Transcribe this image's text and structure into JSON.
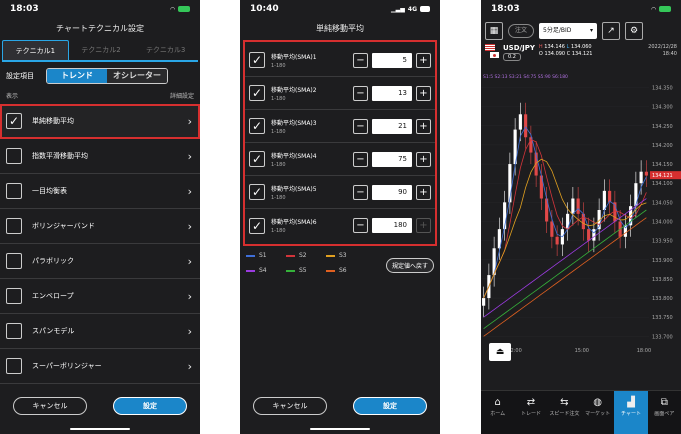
{
  "panel1": {
    "status": {
      "time": "18:03"
    },
    "title": "チャートテクニカル設定",
    "tabs": [
      "テクニカル1",
      "テクニカル2",
      "テクニカル3"
    ],
    "setting_label": "設定項目",
    "segments": [
      "トレンド",
      "オシレーター"
    ],
    "list_header_left": "表示",
    "list_header_right": "詳細設定",
    "items": [
      {
        "label": "単純移動平均",
        "checked": true
      },
      {
        "label": "指数平滑移動平均",
        "checked": false
      },
      {
        "label": "一目均衡表",
        "checked": false
      },
      {
        "label": "ボリンジャーバンド",
        "checked": false
      },
      {
        "label": "パラボリック",
        "checked": false
      },
      {
        "label": "エンベロープ",
        "checked": false
      },
      {
        "label": "スパンモデル",
        "checked": false
      },
      {
        "label": "スーパーボリンジャー",
        "checked": false
      }
    ],
    "cancel_label": "キャンセル",
    "ok_label": "設定"
  },
  "panel2": {
    "status": {
      "time": "10:40",
      "network": "4G"
    },
    "title": "単純移動平均",
    "rows": [
      {
        "name": "移動平均(SMA)1",
        "range": "1-180",
        "value": "5"
      },
      {
        "name": "移動平均(SMA)2",
        "range": "1-180",
        "value": "13"
      },
      {
        "name": "移動平均(SMA)3",
        "range": "1-180",
        "value": "21"
      },
      {
        "name": "移動平均(SMA)4",
        "range": "1-180",
        "value": "75"
      },
      {
        "name": "移動平均(SMA)5",
        "range": "1-180",
        "value": "90"
      },
      {
        "name": "移動平均(SMA)6",
        "range": "1-180",
        "value": "180"
      }
    ],
    "legend": [
      {
        "label": "S1",
        "color": "#3f6fd8"
      },
      {
        "label": "S2",
        "color": "#d2343a"
      },
      {
        "label": "S3",
        "color": "#e0a020"
      },
      {
        "label": "S4",
        "color": "#9b3be0"
      },
      {
        "label": "S5",
        "color": "#35b23a"
      },
      {
        "label": "S6",
        "color": "#e06020"
      }
    ],
    "reset_label": "規定値へ戻す",
    "cancel_label": "キャンセル",
    "ok_label": "設定"
  },
  "panel3": {
    "status": {
      "time": "18:03"
    },
    "order_label": "注文",
    "timeframe": "5分足/BID",
    "symbol": "USD/JPY",
    "spread": "0.2",
    "h_label": "H",
    "h_value": "134.146",
    "l_label": "L",
    "l_value": "134.060",
    "o_label": "O",
    "o_value": "134.090",
    "c_label": "C",
    "c_value": "134.121",
    "date": "2022/12/28",
    "date_time": "18:40",
    "sma_legend": "S1:5  S2:13  S3:21  S4:75  S5:90  S6:180",
    "current_price": "134.121",
    "tabbar": [
      "ホーム",
      "トレード",
      "スピード注文",
      "マーケット",
      "チャート",
      "画面ペア"
    ]
  },
  "chart_data": {
    "type": "candlestick",
    "y_ticks": [
      "134.350",
      "134.300",
      "134.250",
      "134.200",
      "134.150",
      "134.100",
      "134.050",
      "134.000",
      "133.950",
      "133.900",
      "133.850",
      "133.800",
      "133.750",
      "133.700"
    ],
    "x_ticks": [
      "12:00",
      "15:00",
      "18:00"
    ],
    "ylim": [
      133.68,
      134.38
    ],
    "close": [
      133.8,
      133.86,
      133.93,
      133.98,
      134.05,
      134.15,
      134.24,
      134.28,
      134.22,
      134.18,
      134.12,
      134.06,
      134.0,
      133.96,
      133.94,
      133.98,
      134.02,
      134.06,
      134.02,
      133.98,
      133.95,
      133.98,
      134.03,
      134.08,
      134.05,
      134.0,
      133.96,
      133.99,
      134.04,
      134.1,
      134.13,
      134.12
    ],
    "sma_long": [
      133.7,
      133.71,
      133.72,
      133.73,
      133.74,
      133.75,
      133.76,
      133.77,
      133.78,
      133.79,
      133.8,
      133.81,
      133.82,
      133.83,
      133.84,
      133.85,
      133.86,
      133.87,
      133.88,
      133.89,
      133.9,
      133.91,
      133.92,
      133.93,
      133.94,
      133.95,
      133.96,
      133.97,
      133.98,
      133.99,
      134.0,
      134.01
    ]
  }
}
